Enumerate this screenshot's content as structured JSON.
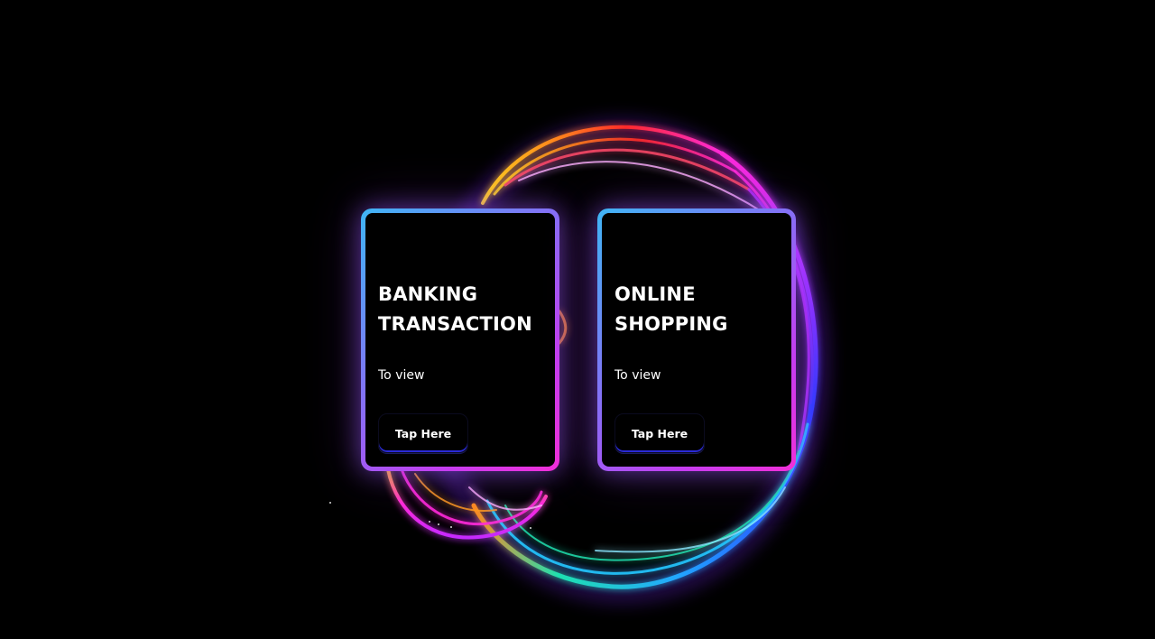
{
  "cards": [
    {
      "title_line1": "BANKING",
      "title_line2": "TRANSACTION",
      "subtitle": "To view",
      "button_label": "Tap Here"
    },
    {
      "title_line1": "ONLINE",
      "title_line2": "SHOPPING",
      "subtitle": "To view",
      "button_label": "Tap Here"
    }
  ],
  "theme": {
    "background": "#000000",
    "card_gradient": [
      "#3fb6f5",
      "#8a6cf6",
      "#c53df0",
      "#f22fd8"
    ],
    "ring_colors": [
      "#ff2a2a",
      "#ff9a1f",
      "#ffd21f",
      "#ff2ad9",
      "#b42cff",
      "#2a6bff",
      "#22c7ff",
      "#1fe0b0"
    ]
  }
}
